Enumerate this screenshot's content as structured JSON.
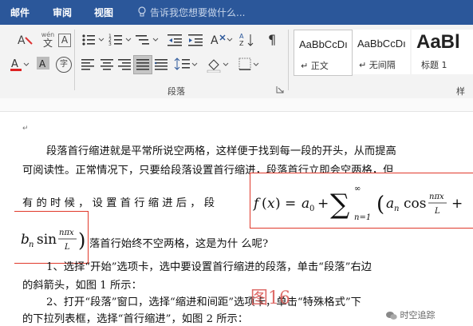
{
  "menubar": {
    "tabs": [
      "邮件",
      "审阅",
      "视图"
    ],
    "tell_me": "告诉我您想要做什么..."
  },
  "ribbon": {
    "group_paragraph_label": "段落",
    "group_styles_label": "样式",
    "styles": [
      {
        "sample": "AaBbCcDı",
        "name": "↵ 正文"
      },
      {
        "sample": "AaBbCcDı",
        "name": "↵ 无间隔"
      },
      {
        "sample": "AaBl",
        "name": "标题 1"
      }
    ],
    "wen_label": "wén",
    "wen_char": "文",
    "box_a": "A",
    "circle_char": "字"
  },
  "document": {
    "para1_line1": "段落首行缩进就是平常所说空两格，这样便于找到每一段的开头，从而提高",
    "para1_line2": "可阅读性。正常情况下，只要给段落设置首行缩进，段落首行立即会空两格，但",
    "para1_line3": "有 的 时 候 ， 设 置 首 行 缩 进 后 ， 段",
    "para1_line4": "落首行始终不空两格，这是为什 么呢?",
    "para2_line1": "1、选择“开始”选项卡，选中要设置首行缩进的段落，单击“段落”右边",
    "para2_line2": "的斜箭头，如图 1 所示：",
    "para3_line1": "2、打开“段落”窗口，选择“缩进和间距”选项卡，单击“特殊格式”下",
    "para3_line2": "的下拉列表框，选择“首行缩进”，如图 2 所示：",
    "figure_label": "图16",
    "wechat_source": "时空追踪",
    "formula_main": "f(x) = a₀ + ∑ₙ₌₁^∞ (aₙ cos(nπx/L) +",
    "formula_cont": "bₙ sin(nπx/L))"
  },
  "colors": {
    "menubar": "#2b579a",
    "highlight_border": "#e0392b"
  }
}
